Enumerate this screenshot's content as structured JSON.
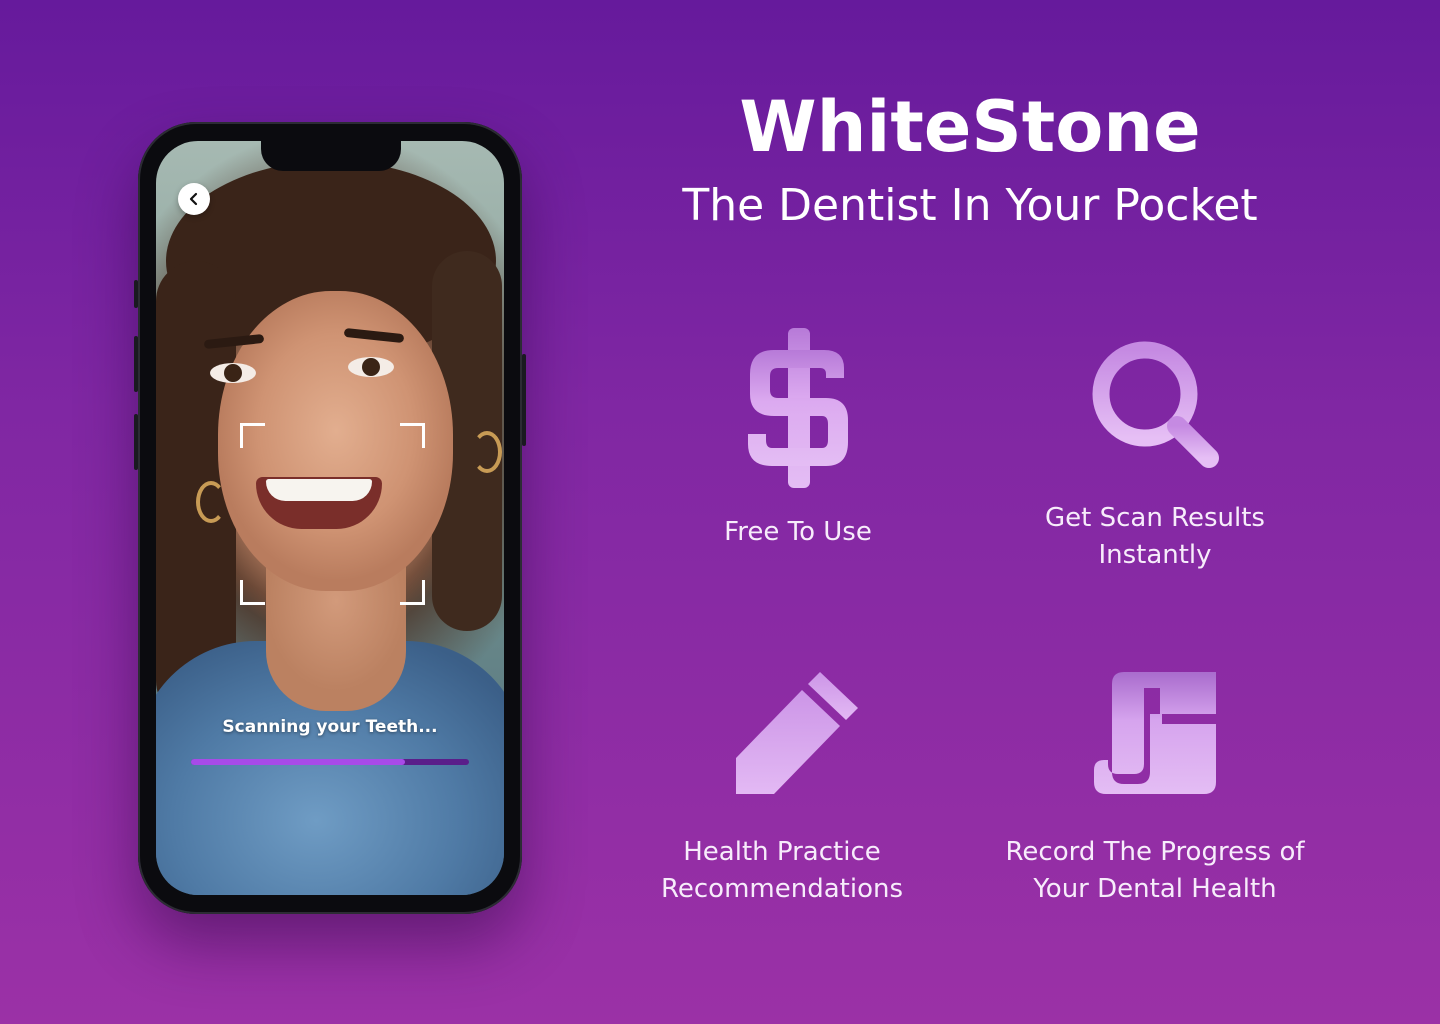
{
  "hero": {
    "title": "WhiteStone",
    "subtitle": "The Dentist In Your Pocket"
  },
  "phone": {
    "scan_label": "Scanning your Teeth...",
    "scan_progress_percent": 77
  },
  "features": [
    {
      "icon": "dollar-icon",
      "line1": "Free To Use",
      "line2": ""
    },
    {
      "icon": "magnifier-icon",
      "line1": "Get Scan Results",
      "line2": "Instantly"
    },
    {
      "icon": "pencil-icon",
      "line1": "Health Practice",
      "line2": "Recommendations"
    },
    {
      "icon": "document-icon",
      "line1": "Record The Progress of",
      "line2": "Your Dental Health"
    }
  ],
  "colors": {
    "background_top": "#661a9c",
    "background_bottom": "#9b31a6",
    "icon_fill": "#dcaaf0",
    "progress_fill": "#a74be8",
    "progress_track": "#5a1e8a"
  }
}
